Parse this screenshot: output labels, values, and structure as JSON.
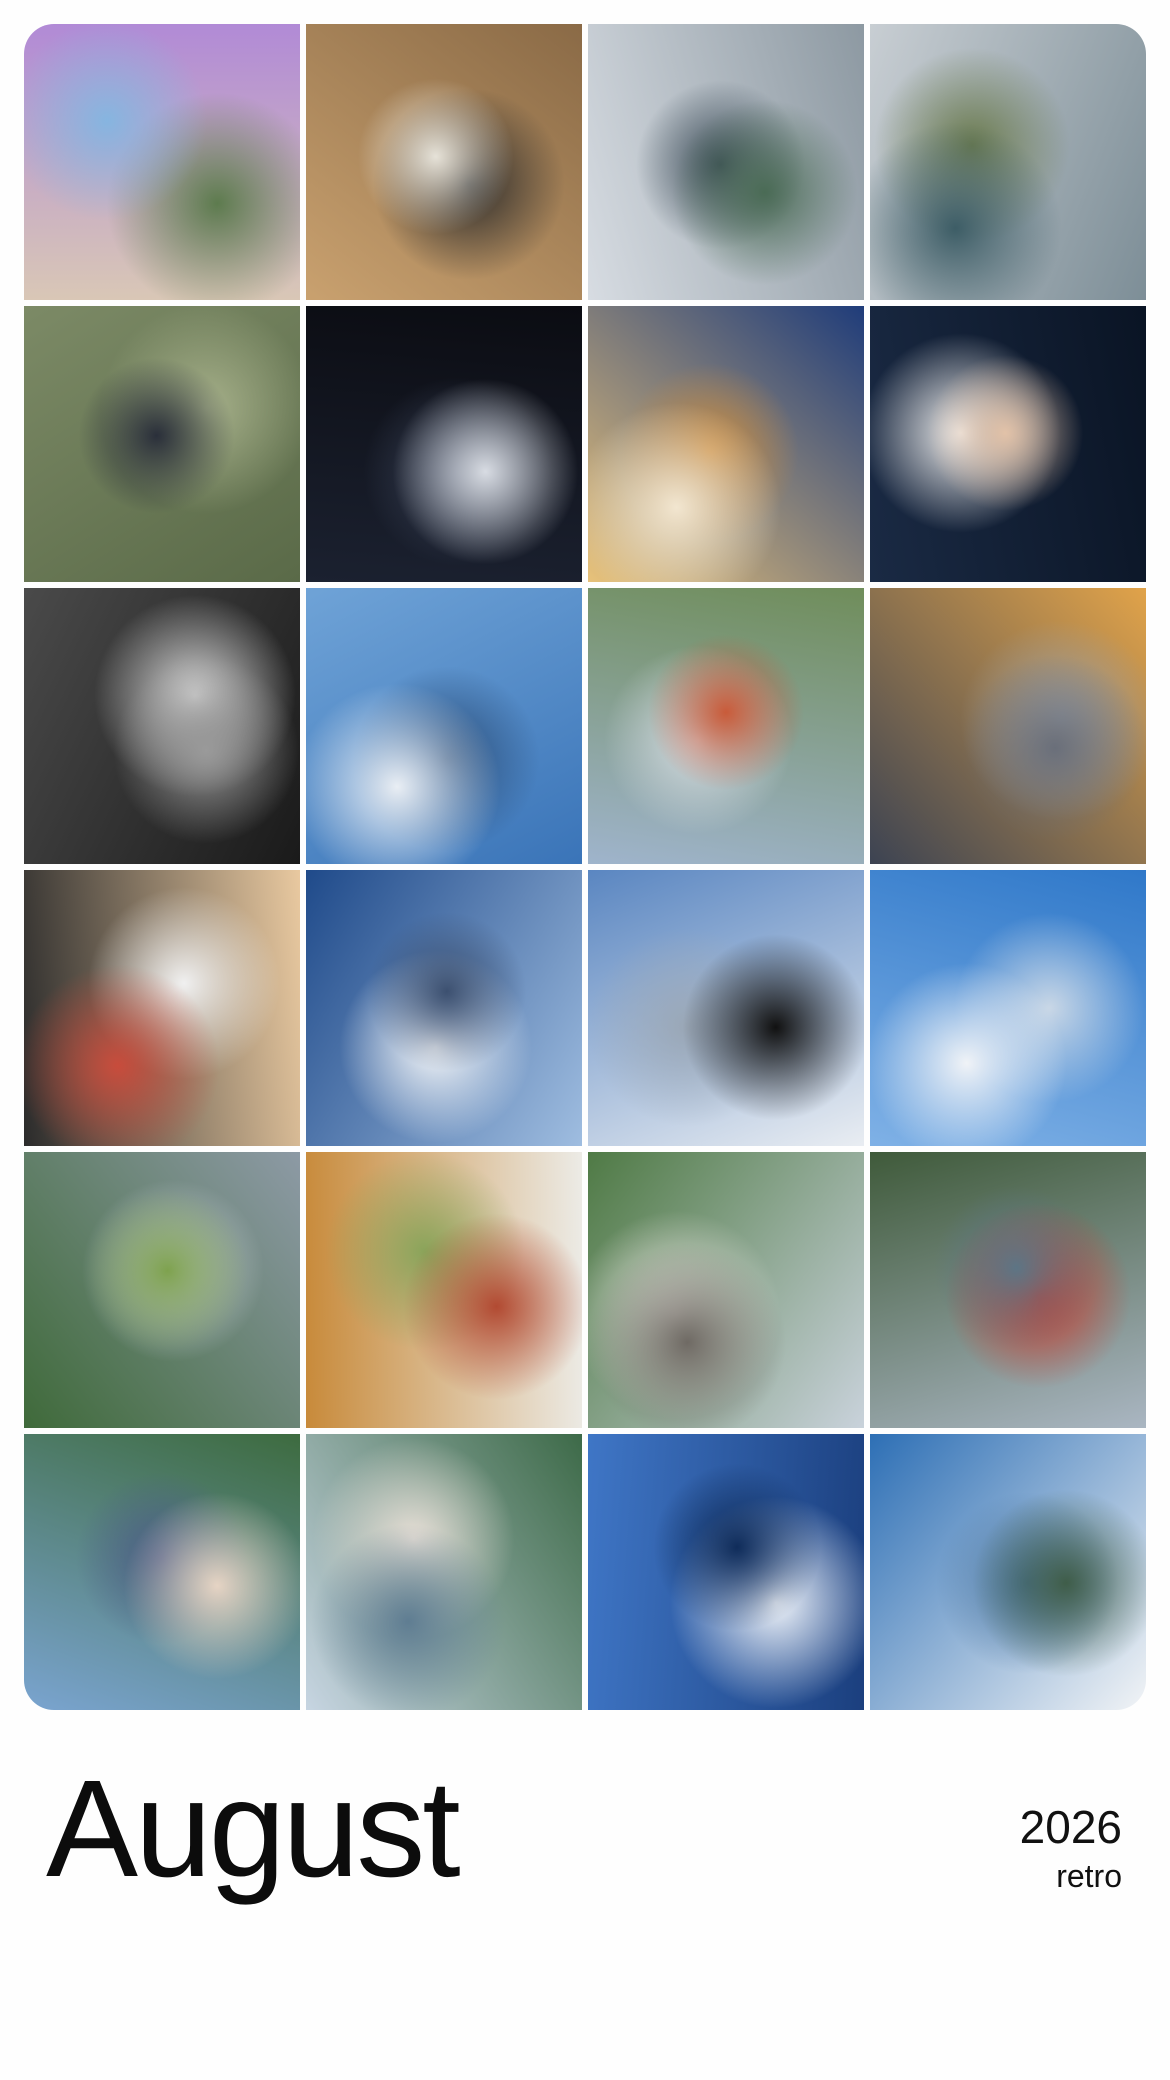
{
  "footer": {
    "month": "August",
    "year": "2026",
    "style_label": "retro"
  },
  "photos": [
    {
      "name": "photo-pink-tumbler-laptop",
      "colors": [
        "#d9c7b6",
        "#b18ad6",
        "#86b5e0",
        "#5d7b4e"
      ]
    },
    {
      "name": "photo-mirror-selfie-archway",
      "colors": [
        "#c9a16f",
        "#8a6a46",
        "#e6e2d8",
        "#2a2a2a"
      ]
    },
    {
      "name": "photo-coast-railing-woman",
      "colors": [
        "#d7dce2",
        "#8d99a2",
        "#4a6b55",
        "#3b4b57"
      ]
    },
    {
      "name": "photo-bench-ocean-view",
      "colors": [
        "#c8ced3",
        "#7d8e97",
        "#3d5d66",
        "#6b7b4f"
      ]
    },
    {
      "name": "photo-woman-petting-black-cat",
      "colors": [
        "#7c8a66",
        "#5a6a48",
        "#2a2f3a",
        "#a6b08a"
      ]
    },
    {
      "name": "photo-night-harbor-lights",
      "colors": [
        "#0b0c12",
        "#1b2130",
        "#d8dce3",
        "#3a4358"
      ]
    },
    {
      "name": "photo-burger-and-fries",
      "colors": [
        "#1f3c7a",
        "#e8c27a",
        "#f2e6d0",
        "#c98b3f"
      ]
    },
    {
      "name": "photo-night-selfie-waterfront",
      "colors": [
        "#0a1424",
        "#1a2a44",
        "#e2c2a8",
        "#f1f1f1"
      ]
    },
    {
      "name": "photo-family-black-and-white",
      "colors": [
        "#1a1a1a",
        "#4a4a4a",
        "#9a9a9a",
        "#d8d8d8"
      ]
    },
    {
      "name": "photo-flight-path-collage",
      "colors": [
        "#3a74b8",
        "#6fa3d7",
        "#e9eef4",
        "#2c4f7a"
      ]
    },
    {
      "name": "photo-airplane-wing-runway",
      "colors": [
        "#9fb4cc",
        "#6f8d5a",
        "#c95b3a",
        "#d7dde3"
      ]
    },
    {
      "name": "photo-sunset-airport-tarmac",
      "colors": [
        "#3c4352",
        "#e1a34a",
        "#6a6f7a",
        "#9ea3a9"
      ]
    },
    {
      "name": "photo-sandwich-in-hand",
      "colors": [
        "#2b2b2b",
        "#e9c9a0",
        "#c84c3c",
        "#f0f0f0"
      ]
    },
    {
      "name": "photo-wing-above-clouds-sunlight",
      "colors": [
        "#1f4a8a",
        "#9fbde0",
        "#3c5070",
        "#f4f6f8"
      ]
    },
    {
      "name": "photo-boarding-pass-window",
      "colors": [
        "#5a86c1",
        "#e9edf2",
        "#111111",
        "#9aa7b6"
      ]
    },
    {
      "name": "photo-wing-over-cloud-sea",
      "colors": [
        "#2f78c9",
        "#7fb1e6",
        "#f0f3f7",
        "#c9d7e6"
      ]
    },
    {
      "name": "photo-wing-over-golf-course",
      "colors": [
        "#8d9aa5",
        "#3f6a3a",
        "#7ea24e",
        "#c8d0d7"
      ]
    },
    {
      "name": "photo-takeout-box-sandwich",
      "colors": [
        "#ecebe6",
        "#c88a3a",
        "#b24a32",
        "#8aa45a"
      ]
    },
    {
      "name": "photo-ship-deck-balcony",
      "colors": [
        "#c9d2db",
        "#4f7a45",
        "#6f6a64",
        "#e9e6e0"
      ]
    },
    {
      "name": "photo-harbor-red-ship",
      "colors": [
        "#aab6c2",
        "#3f5a3a",
        "#5d7585",
        "#c93a2e"
      ]
    },
    {
      "name": "photo-two-friends-harbor",
      "colors": [
        "#7aa4d0",
        "#3d6b3f",
        "#e6d4c4",
        "#4b5c86"
      ]
    },
    {
      "name": "photo-woman-ship-railing",
      "colors": [
        "#c7d5e2",
        "#3d6a48",
        "#5f7d92",
        "#e7dfd6"
      ]
    },
    {
      "name": "photo-open-ocean-wake",
      "colors": [
        "#3f76c6",
        "#1b3f7e",
        "#0f2c5a",
        "#f2f6fb"
      ]
    },
    {
      "name": "photo-island-coastline-clouds",
      "colors": [
        "#2d6fb5",
        "#f2f4f6",
        "#3f5d49",
        "#4d78a2"
      ]
    }
  ]
}
